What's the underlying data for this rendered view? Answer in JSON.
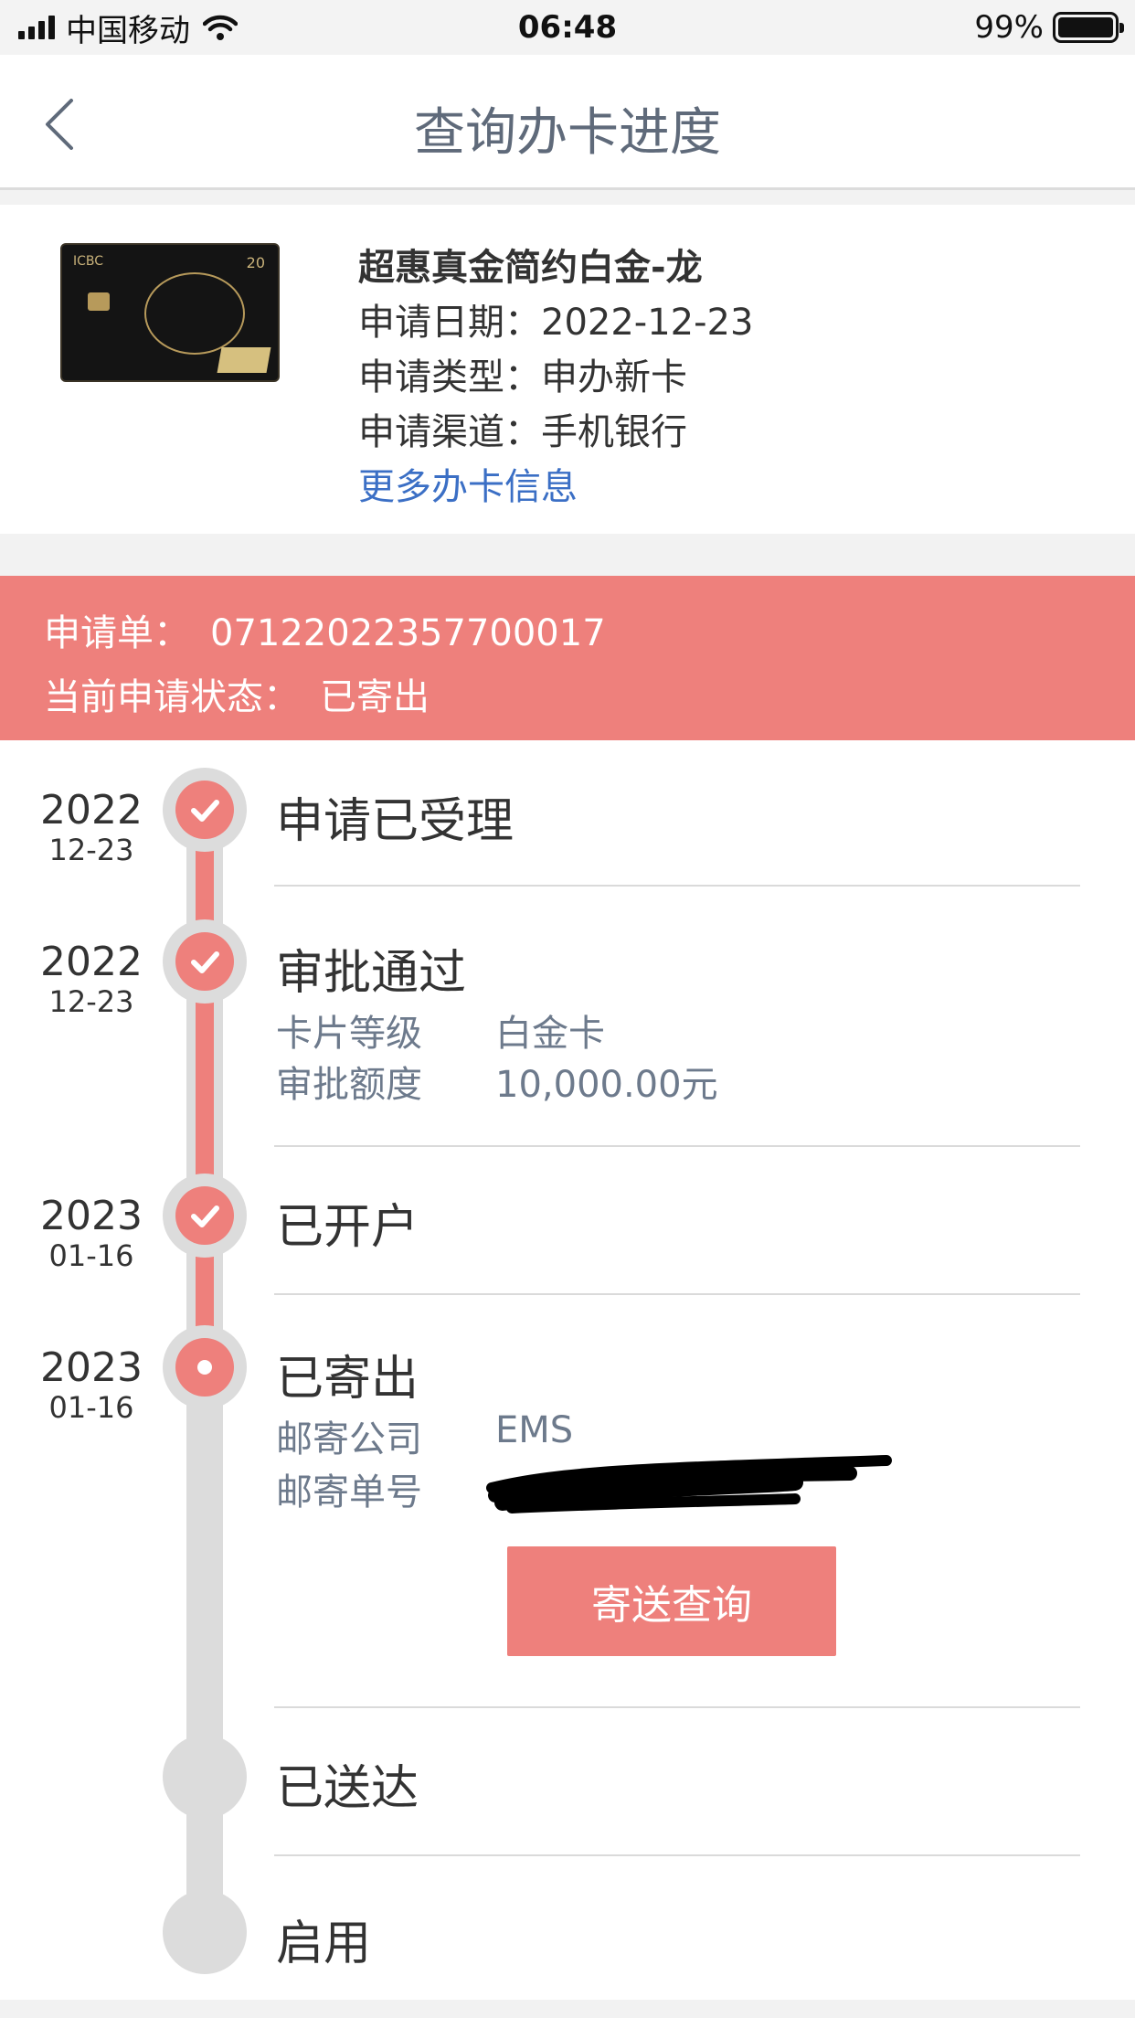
{
  "status_bar": {
    "carrier": "中国移动",
    "time": "06:48",
    "battery_percent": "99%"
  },
  "nav": {
    "title": "查询办卡进度"
  },
  "card": {
    "name": "超惠真金简约白金-龙",
    "apply_date": "申请日期：2022-12-23",
    "apply_type": "申请类型：申办新卡",
    "apply_channel": "申请渠道：手机银行",
    "more_link": "更多办卡信息"
  },
  "banner": {
    "app_no_label": "申请单：",
    "app_no_value": "07122022357700017",
    "status_label": "当前申请状态：",
    "status_value": "已寄出"
  },
  "timeline": [
    {
      "year": "2022",
      "md": "12-23",
      "title": "申请已受理",
      "state": "done"
    },
    {
      "year": "2022",
      "md": "12-23",
      "title": "审批通过",
      "state": "done",
      "details": [
        {
          "label": "卡片等级",
          "value": "白金卡"
        },
        {
          "label": "审批额度",
          "value": "10,000.00元"
        }
      ]
    },
    {
      "year": "2023",
      "md": "01-16",
      "title": "已开户",
      "state": "done"
    },
    {
      "year": "2023",
      "md": "01-16",
      "title": "已寄出",
      "state": "current",
      "details": [
        {
          "label": "邮寄公司",
          "value": "EMS"
        },
        {
          "label": "邮寄单号",
          "value": ""
        }
      ]
    },
    {
      "title": "已送达",
      "state": "pending"
    },
    {
      "title": "启用",
      "state": "pending"
    }
  ],
  "track_button": "寄送查询",
  "colors": {
    "accent": "#ee807c",
    "link": "#3b6fc5",
    "track_gray": "#dcdcdc"
  }
}
